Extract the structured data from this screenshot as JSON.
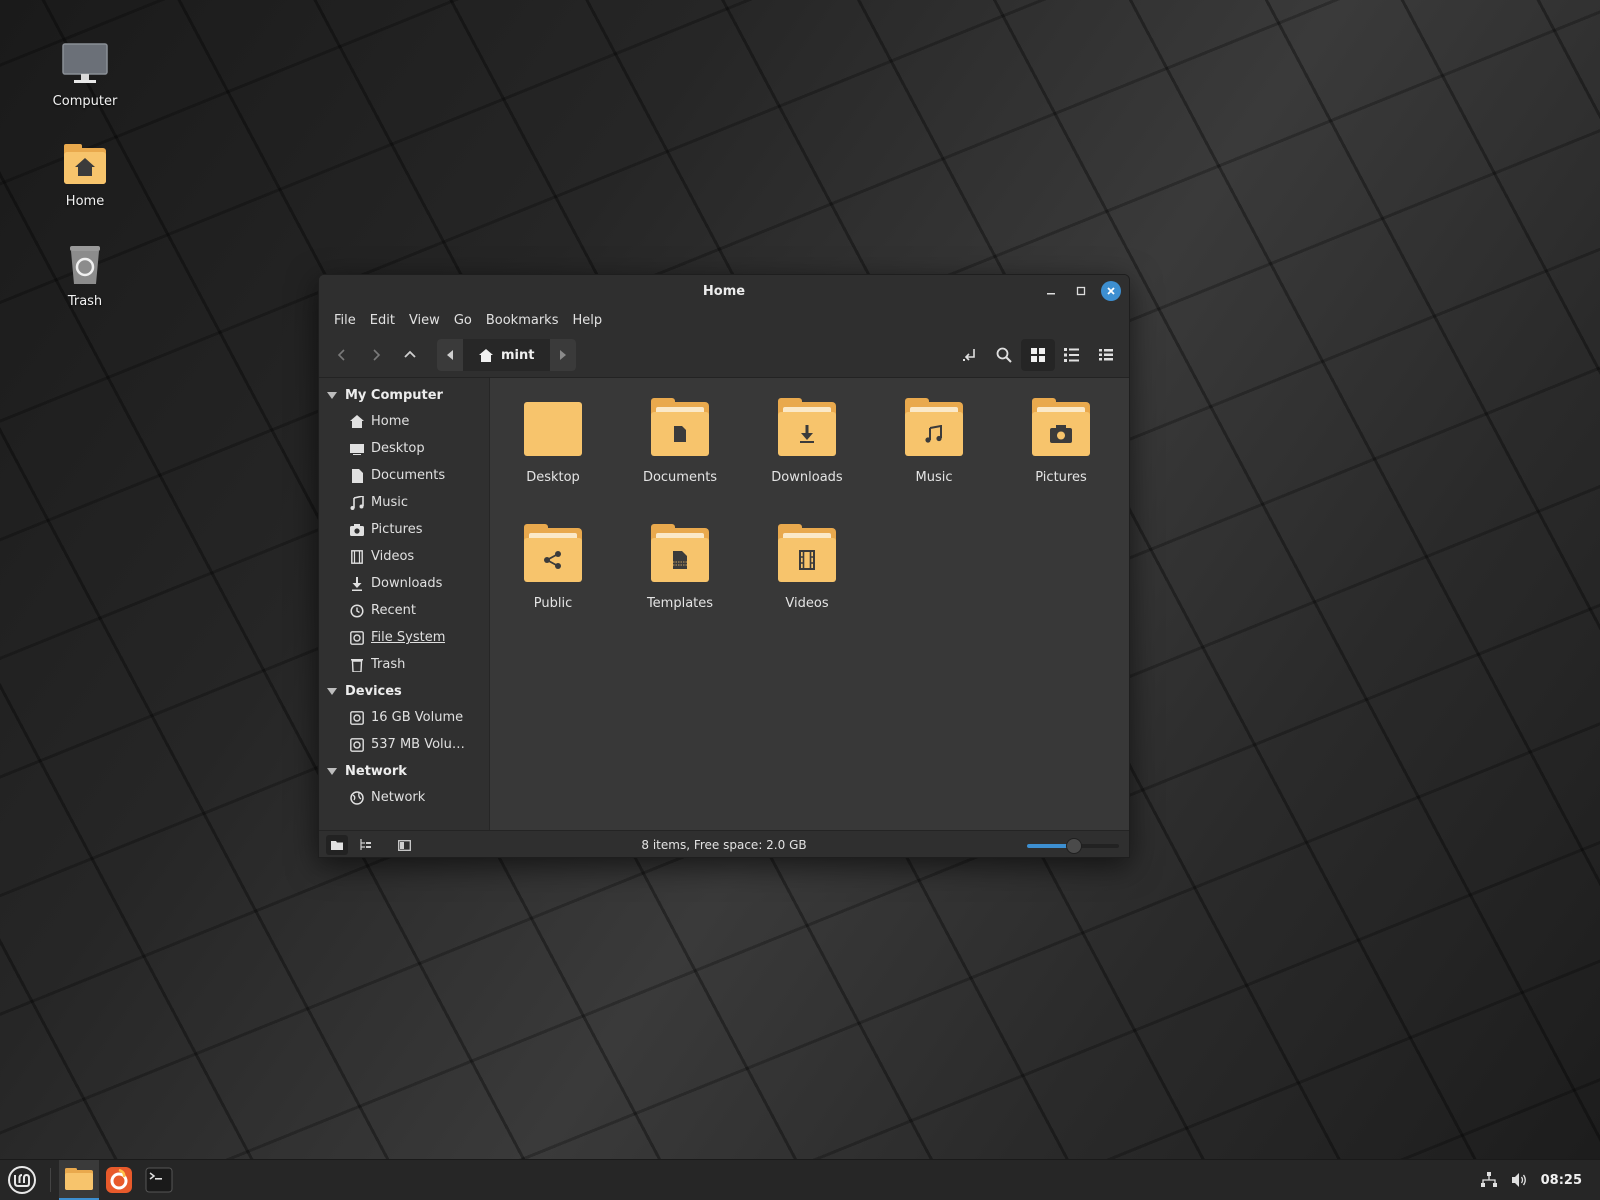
{
  "desktop": {
    "icons": [
      {
        "label": "Computer",
        "icon": "monitor-icon"
      },
      {
        "label": "Home",
        "icon": "home-folder-icon"
      },
      {
        "label": "Trash",
        "icon": "trash-icon"
      }
    ]
  },
  "window": {
    "title": "Home",
    "menu": [
      "File",
      "Edit",
      "View",
      "Go",
      "Bookmarks",
      "Help"
    ],
    "path": {
      "current": "mint"
    },
    "sidebar": {
      "sections": [
        {
          "header": "My Computer",
          "items": [
            "Home",
            "Desktop",
            "Documents",
            "Music",
            "Pictures",
            "Videos",
            "Downloads",
            "Recent",
            "File System",
            "Trash"
          ]
        },
        {
          "header": "Devices",
          "items": [
            "16 GB Volume",
            "537 MB Volu…"
          ]
        },
        {
          "header": "Network",
          "items": [
            "Network"
          ]
        }
      ]
    },
    "files": [
      {
        "name": "Desktop",
        "emblem": "none"
      },
      {
        "name": "Documents",
        "emblem": "document-icon"
      },
      {
        "name": "Downloads",
        "emblem": "download-icon"
      },
      {
        "name": "Music",
        "emblem": "music-note-icon"
      },
      {
        "name": "Pictures",
        "emblem": "camera-icon"
      },
      {
        "name": "Public",
        "emblem": "share-icon"
      },
      {
        "name": "Templates",
        "emblem": "template-icon"
      },
      {
        "name": "Videos",
        "emblem": "film-icon"
      }
    ],
    "status": "8 items, Free space: 2.0 GB",
    "zoom_level": 0.5
  },
  "taskbar": {
    "clock": "08:25"
  },
  "colors": {
    "accent": "#3d8fd1",
    "folder": "#f7c46c",
    "folder_back": "#e9a94d"
  }
}
